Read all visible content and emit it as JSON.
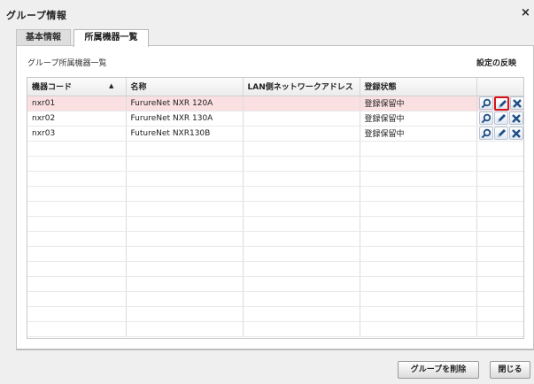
{
  "window": {
    "title": "グループ情報",
    "close_glyph": "×"
  },
  "tabs": [
    {
      "label": "基本情報",
      "active": false
    },
    {
      "label": "所属機器一覧",
      "active": true
    }
  ],
  "panel": {
    "list_title": "グループ所属機器一覧",
    "reflect_link": "設定の反映"
  },
  "table": {
    "columns": [
      {
        "label": "機器コード",
        "sort": "ascending",
        "sort_glyph": "▲"
      },
      {
        "label": "名称"
      },
      {
        "label": "LAN側ネットワークアドレス"
      },
      {
        "label": "登録状態"
      },
      {
        "label": ""
      }
    ],
    "rows": [
      {
        "code": "nxr01",
        "name": "FurureNet NXR 120A",
        "lan": "",
        "status": "登録保留中",
        "selected": true
      },
      {
        "code": "nxr02",
        "name": "FurureNet NXR 130A",
        "lan": "",
        "status": "登録保留中",
        "selected": false
      },
      {
        "code": "nxr03",
        "name": "FutureNet NXR130B",
        "lan": "",
        "status": "登録保留中",
        "selected": false
      }
    ],
    "row_actions": [
      "search-icon",
      "pencil-icon",
      "delete-x-icon"
    ]
  },
  "footer": {
    "delete_group_button": "グループを削除",
    "close_button": "閉じる"
  },
  "colors": {
    "selected_row": "#fbe0e2",
    "highlight_border": "#d8121b",
    "icon_blue": "#1f4f86"
  }
}
